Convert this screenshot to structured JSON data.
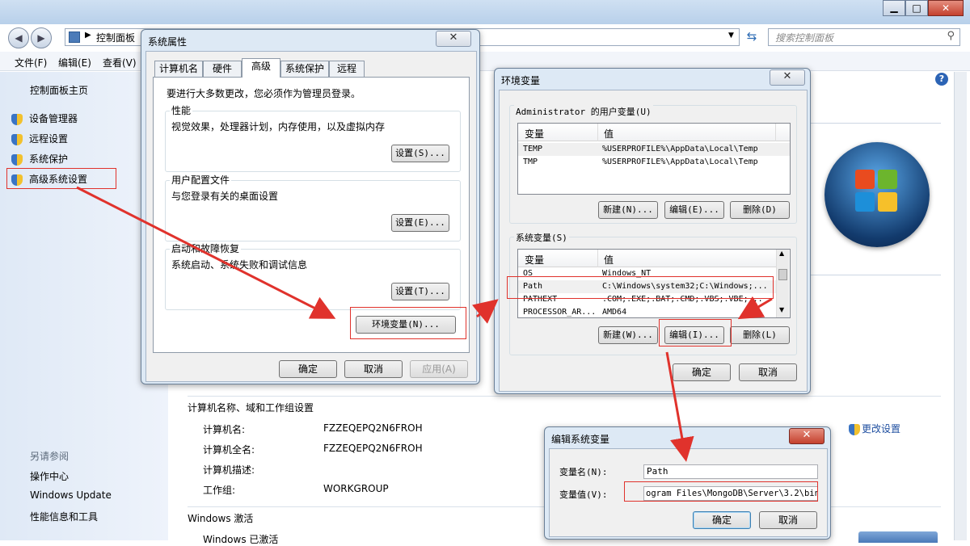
{
  "bg_window": {
    "breadcrumb": "控制面板",
    "search_placeholder": "搜索控制面板",
    "menu": [
      "文件(F)",
      "编辑(E)",
      "查看(V)"
    ],
    "sidebar_home": "控制面板主页",
    "sidebar_items": [
      "设备管理器",
      "远程设置",
      "系统保护",
      "高级系统设置"
    ],
    "see_also_title": "另请参阅",
    "see_also_items": [
      "操作中心",
      "Windows Update",
      "性能信息和工具"
    ],
    "computer_section_title": "计算机名称、域和工作组设置",
    "computer_rows": [
      {
        "label": "计算机名:",
        "value": "FZZEQEPQ2N6FROH"
      },
      {
        "label": "计算机全名:",
        "value": "FZZEQEPQ2N6FROH"
      },
      {
        "label": "计算机描述:",
        "value": ""
      },
      {
        "label": "工作组:",
        "value": "WORKGROUP"
      }
    ],
    "change_settings": "更改设置",
    "activation_title": "Windows 激活",
    "activation_status": "Windows 已激活"
  },
  "sys_props": {
    "title": "系统属性",
    "tabs": [
      "计算机名",
      "硬件",
      "高级",
      "系统保护",
      "远程"
    ],
    "active_tab": "高级",
    "admin_note": "要进行大多数更改，您必须作为管理员登录。",
    "perf_title": "性能",
    "perf_desc": "视觉效果，处理器计划，内存使用，以及虚拟内存",
    "perf_btn": "设置(S)...",
    "profile_title": "用户配置文件",
    "profile_desc": "与您登录有关的桌面设置",
    "profile_btn": "设置(E)...",
    "startup_title": "启动和故障恢复",
    "startup_desc": "系统启动、系统失败和调试信息",
    "startup_btn": "设置(T)...",
    "env_btn": "环境变量(N)...",
    "ok": "确定",
    "cancel": "取消",
    "apply": "应用(A)"
  },
  "env_vars": {
    "title": "环境变量",
    "user_group": "Administrator 的用户变量(U)",
    "col_var": "变量",
    "col_val": "值",
    "user_vars": [
      {
        "name": "TEMP",
        "value": "%USERPROFILE%\\AppData\\Local\\Temp"
      },
      {
        "name": "TMP",
        "value": "%USERPROFILE%\\AppData\\Local\\Temp"
      }
    ],
    "user_new": "新建(N)...",
    "user_edit": "编辑(E)...",
    "user_delete": "删除(D)",
    "sys_group": "系统变量(S)",
    "sys_vars": [
      {
        "name": "OS",
        "value": "Windows_NT"
      },
      {
        "name": "Path",
        "value": "C:\\Windows\\system32;C:\\Windows;..."
      },
      {
        "name": "PATHEXT",
        "value": ".COM;.EXE;.BAT;.CMD;.VBS;.VBE;..."
      },
      {
        "name": "PROCESSOR_AR...",
        "value": "AMD64"
      }
    ],
    "sys_new": "新建(W)...",
    "sys_edit": "编辑(I)...",
    "sys_delete": "删除(L)",
    "ok": "确定",
    "cancel": "取消"
  },
  "edit_var": {
    "title": "编辑系统变量",
    "name_label": "变量名(N):",
    "name_value": "Path",
    "value_label": "变量值(V):",
    "value_value": "ogram Files\\MongoDB\\Server\\3.2\\bin;",
    "ok": "确定",
    "cancel": "取消"
  },
  "accent_red": "#e0322c"
}
